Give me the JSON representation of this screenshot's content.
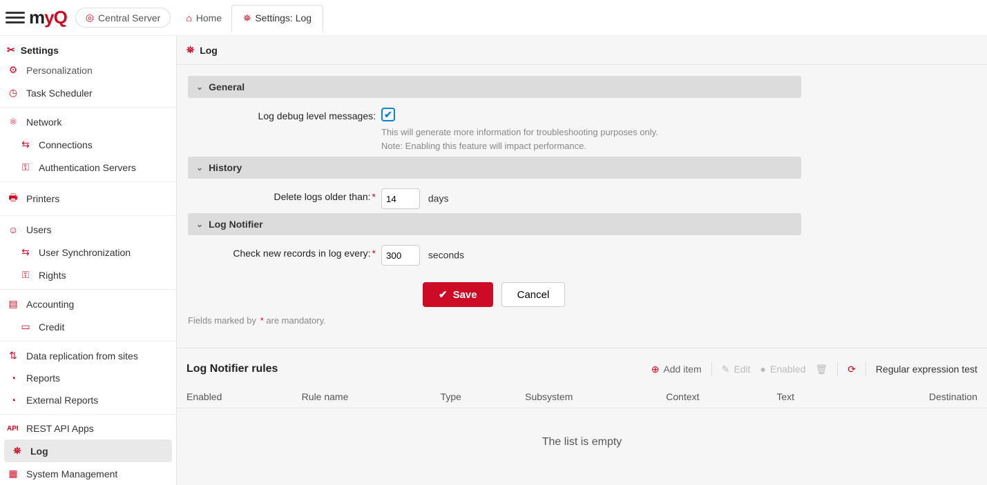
{
  "topbar": {
    "server_label": "Central Server",
    "home_label": "Home",
    "active_tab": "Settings: Log"
  },
  "sidebar": {
    "title": "Settings",
    "items": [
      {
        "icon": "personalization-icon",
        "label": "Personalization",
        "cut": true
      },
      {
        "icon": "clock-icon",
        "label": "Task Scheduler"
      },
      {
        "sep": true
      },
      {
        "icon": "network-icon",
        "label": "Network"
      },
      {
        "icon": "connections-icon",
        "label": "Connections",
        "sub": true
      },
      {
        "icon": "auth-icon",
        "label": "Authentication Servers",
        "sub": true
      },
      {
        "sep": true
      },
      {
        "icon": "printer-icon",
        "label": "Printers"
      },
      {
        "sep": true
      },
      {
        "icon": "user-icon",
        "label": "Users"
      },
      {
        "icon": "usersync-icon",
        "label": "User Synchronization",
        "sub": true
      },
      {
        "icon": "rights-icon",
        "label": "Rights",
        "sub": true
      },
      {
        "sep": true
      },
      {
        "icon": "accounting-icon",
        "label": "Accounting"
      },
      {
        "icon": "credit-icon",
        "label": "Credit",
        "sub": true
      },
      {
        "sep": true
      },
      {
        "icon": "replication-icon",
        "label": "Data replication from sites"
      },
      {
        "icon": "reports-icon",
        "label": "Reports"
      },
      {
        "icon": "extreports-icon",
        "label": "External Reports"
      },
      {
        "sep": true
      },
      {
        "icon": "api-icon",
        "label": "REST API Apps"
      },
      {
        "icon": "log-icon",
        "label": "Log",
        "active": true
      },
      {
        "icon": "sysmgmt-icon",
        "label": "System Management"
      }
    ]
  },
  "page": {
    "title": "Log",
    "general": {
      "header": "General",
      "debug_label": "Log debug level messages:",
      "debug_checked": true,
      "help1": "This will generate more information for troubleshooting purposes only.",
      "help2": "Note: Enabling this feature will impact performance."
    },
    "history": {
      "header": "History",
      "delete_label": "Delete logs older than:",
      "value": "14",
      "unit": "days"
    },
    "notifier": {
      "header": "Log Notifier",
      "check_label": "Check new records in log every:",
      "value": "300",
      "unit": "seconds"
    },
    "save": "Save",
    "cancel": "Cancel",
    "mandatory_prefix": "Fields marked by ",
    "mandatory_suffix": " are mandatory."
  },
  "rules": {
    "title": "Log Notifier rules",
    "add": "Add item",
    "edit": "Edit",
    "enabled": "Enabled",
    "regex": "Regular expression test",
    "columns": [
      "Enabled",
      "Rule name",
      "Type",
      "Subsystem",
      "Context",
      "Text",
      "Destination"
    ],
    "empty": "The list is empty"
  }
}
